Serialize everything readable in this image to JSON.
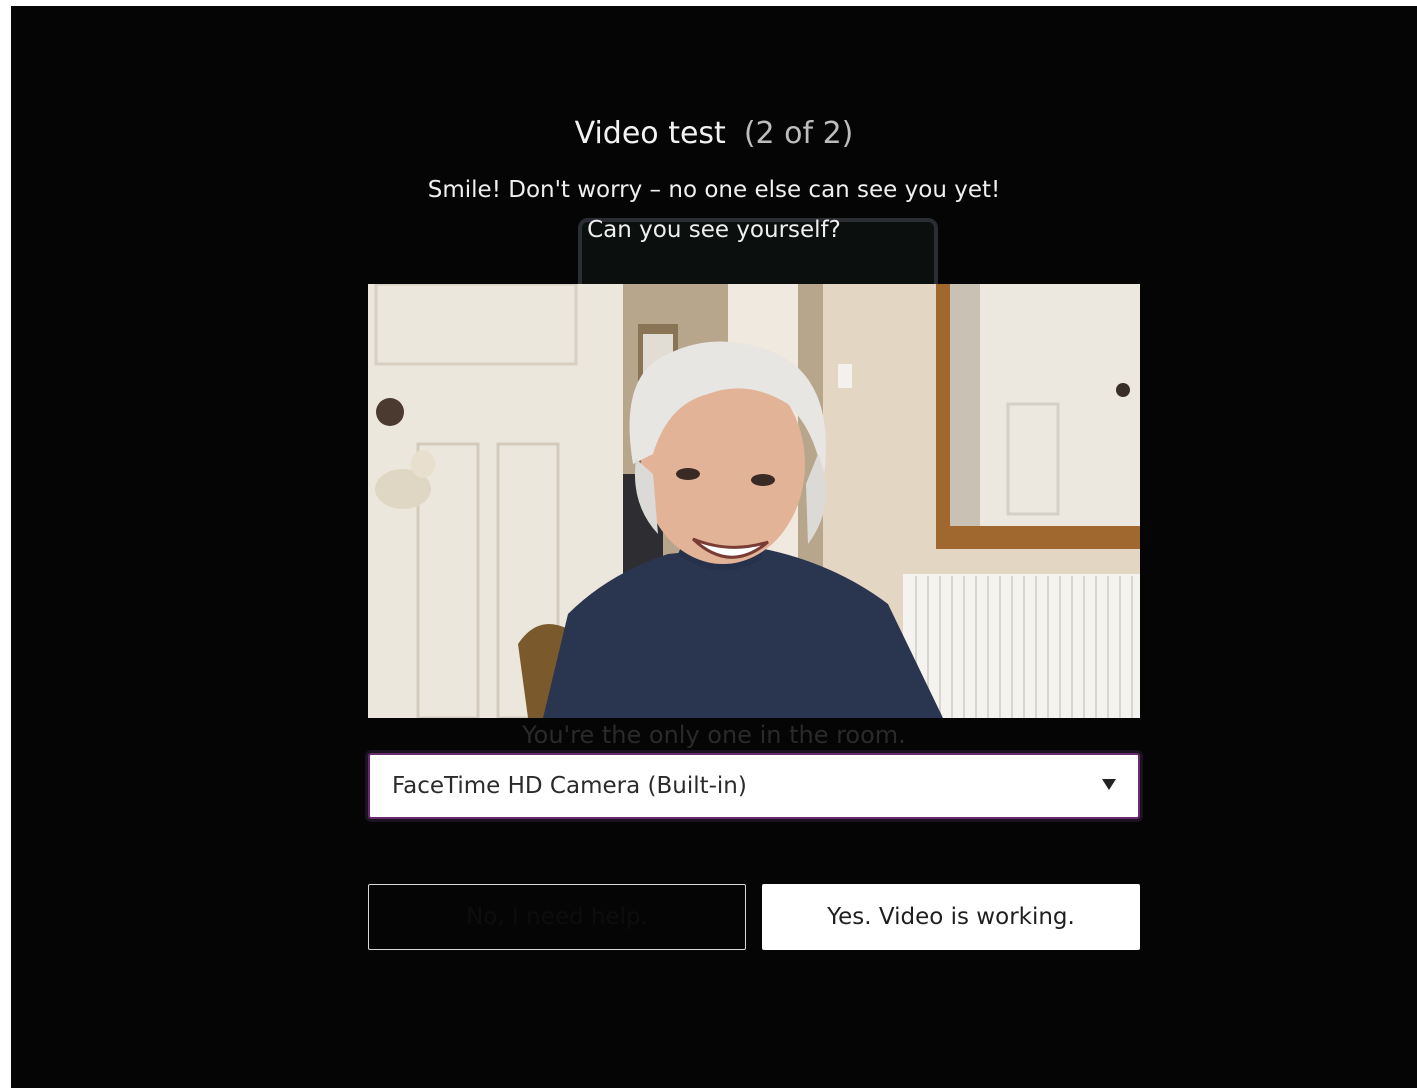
{
  "header": {
    "title": "Video test",
    "step": "(2 of 2)"
  },
  "instructions": {
    "line1": "Smile! Don't worry – no one else can see you yet!",
    "line2": "Can you see yourself?"
  },
  "background_hint": {
    "room_status": "You're the only one in the room."
  },
  "camera": {
    "selected": "FaceTime HD Camera (Built-in)"
  },
  "buttons": {
    "no_label": "No, I need help.",
    "yes_label": "Yes. Video is working."
  },
  "colors": {
    "background": "#050505",
    "text": "#f2f2f2",
    "select_border": "#6a2a6e",
    "button_yes_bg": "#ffffff"
  }
}
